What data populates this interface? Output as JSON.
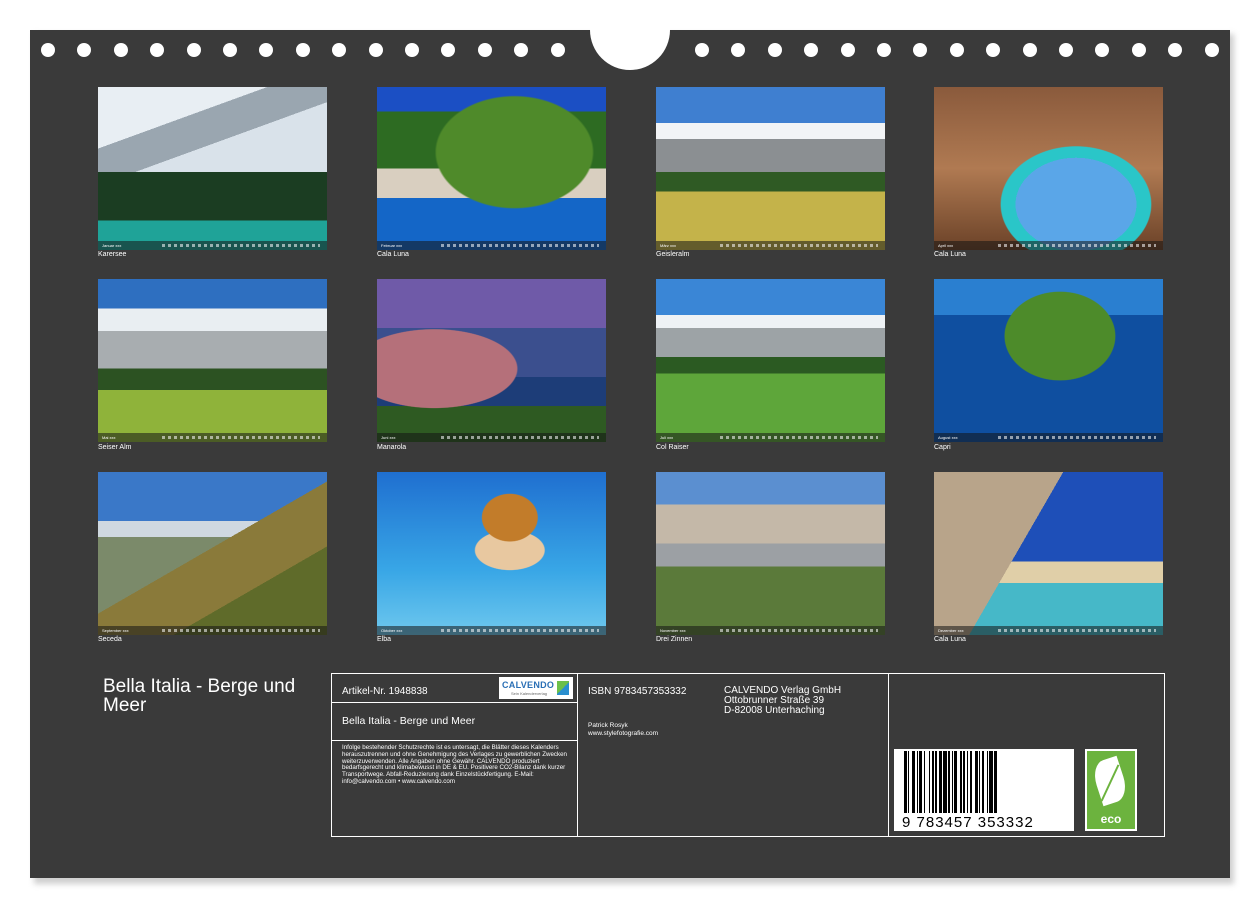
{
  "calendar_title": "Bella Italia - Berge und Meer",
  "photos": [
    {
      "caption": "Karersee",
      "month": "Januar xxx"
    },
    {
      "caption": "Cala Luna",
      "month": "Februar xxx"
    },
    {
      "caption": "Geisleralm",
      "month": "März xxx"
    },
    {
      "caption": "Cala Luna",
      "month": "April xxx"
    },
    {
      "caption": "Seiser Alm",
      "month": "Mai xxx"
    },
    {
      "caption": "Manarola",
      "month": "Juni xxx"
    },
    {
      "caption": "Col Raiser",
      "month": "Juli xxx"
    },
    {
      "caption": "Capri",
      "month": "August xxx"
    },
    {
      "caption": "Seceda",
      "month": "September xxx"
    },
    {
      "caption": "Elba",
      "month": "Oktober xxx"
    },
    {
      "caption": "Drei Zinnen",
      "month": "November xxx"
    },
    {
      "caption": "Cala Luna",
      "month": "Dezember xxx"
    }
  ],
  "info": {
    "article": "Artikel-Nr. 1948838",
    "logo_name": "CALVENDO",
    "logo_sub": "Sein Kalenderverlag",
    "box_title": "Bella Italia - Berge und Meer",
    "legal": "Infolge bestehender Schutzrechte ist es untersagt, die Blätter dieses Kalenders herauszutrennen und ohne Genehmigung des Verlages zu gewerblichen Zwecken weiterzuverwenden. Alle Angaben ohne Gewähr. CALVENDO produziert bedarfsgerecht und klimabewusst in DE & EU. Positivere CO2-Bilanz dank kurzer Transportwege. Abfall-Reduzierung dank Einzelstückfertigung. E-Mail: info@calvendo.com • www.calvendo.com",
    "isbn": "ISBN 9783457353332",
    "author": "Patrick Rosyk",
    "author_site": "www.stylefotografie.com",
    "publisher_lines": [
      "CALVENDO Verlag GmbH",
      "Ottobrunner Straße 39",
      "D-82008 Unterhaching"
    ],
    "barcode_number": "9 783457 353332",
    "eco_label": "eco"
  }
}
